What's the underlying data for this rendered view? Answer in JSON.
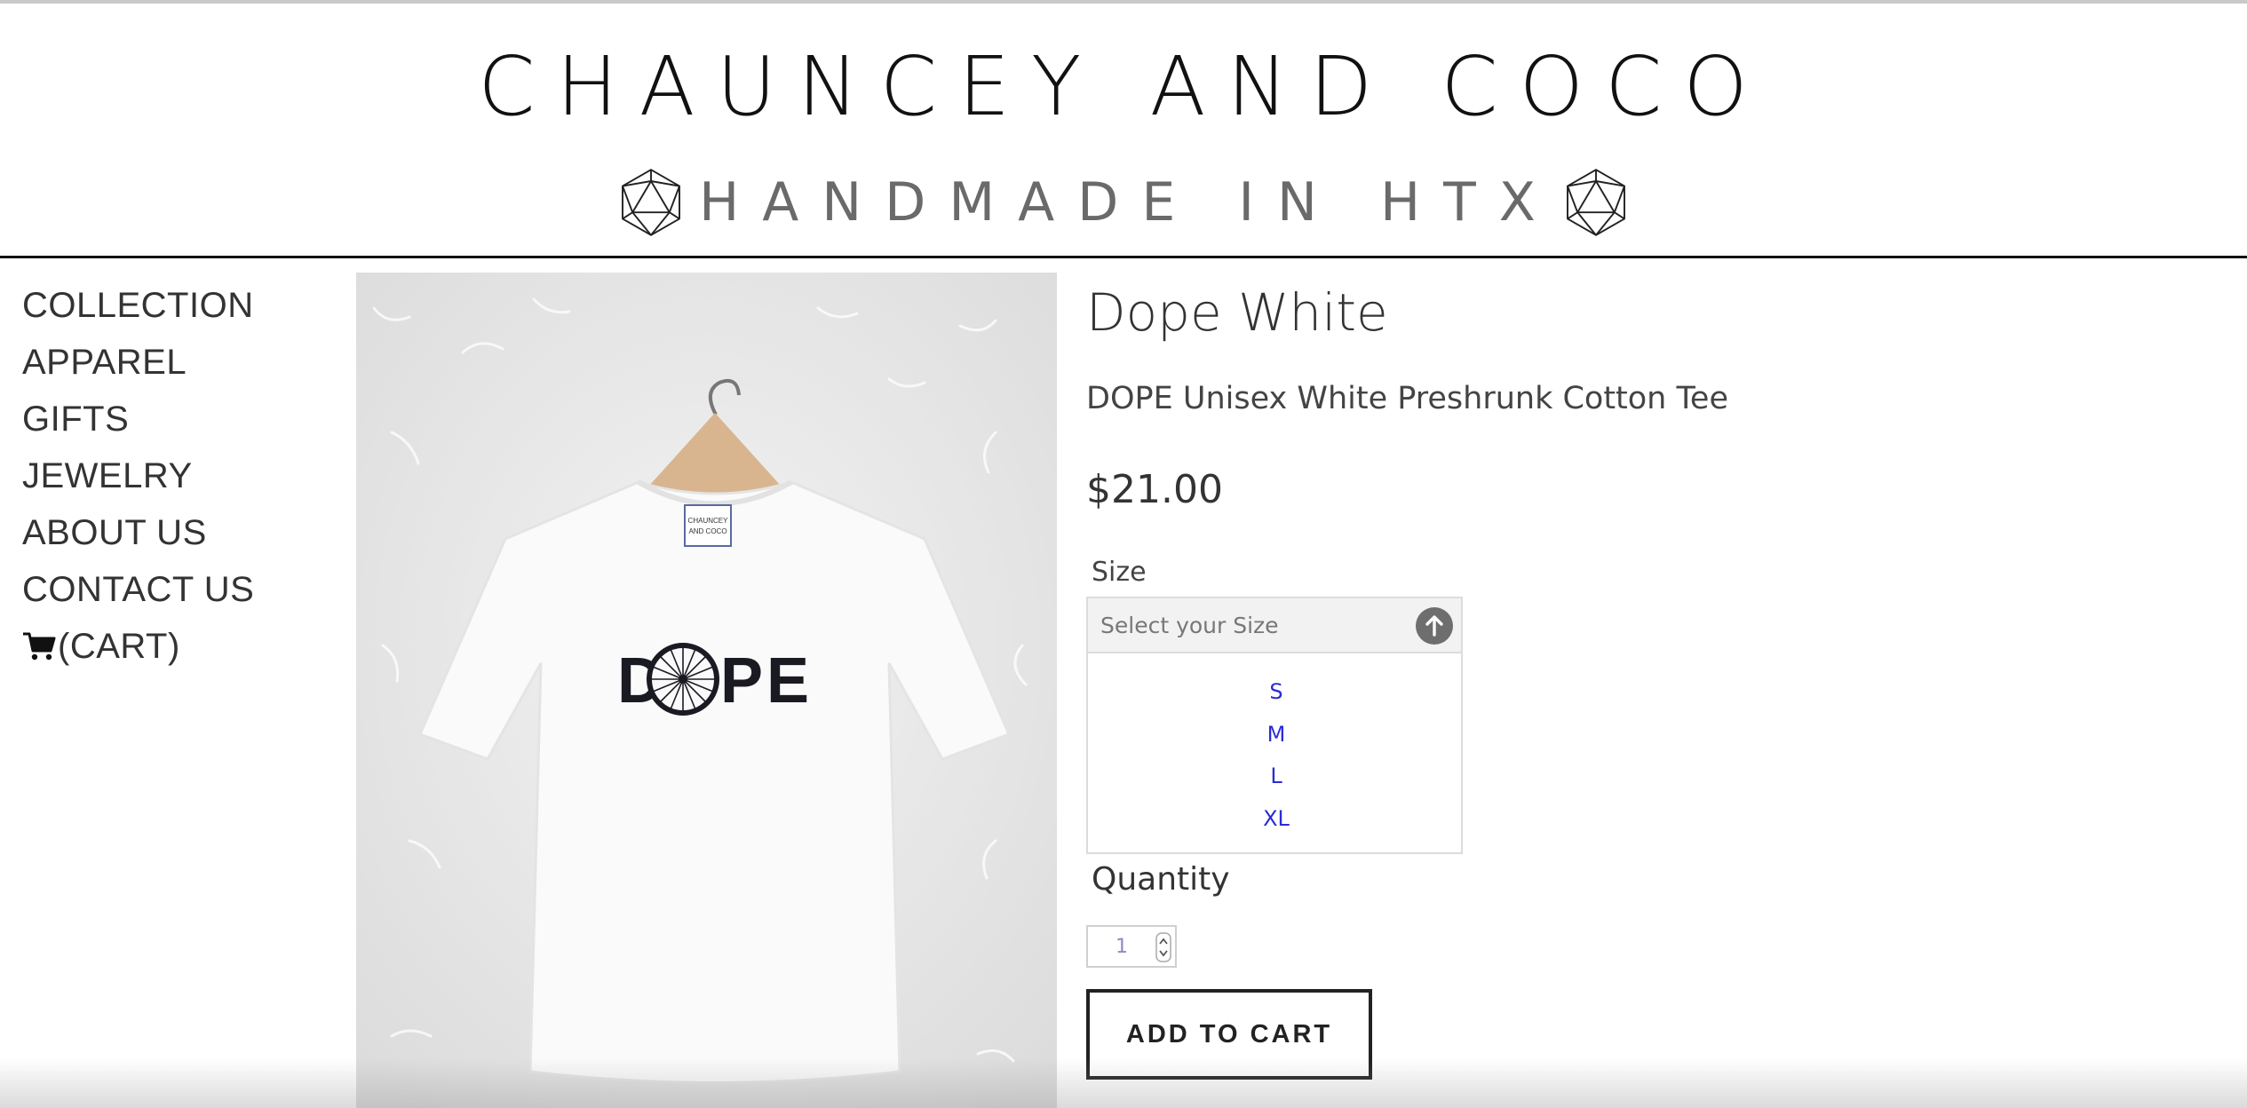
{
  "header": {
    "brand": "CHAUNCEY AND COCO",
    "tagline": "HANDMADE IN HTX",
    "left_icon": "geodesic-gem-icon",
    "right_icon": "geodesic-gem-icon"
  },
  "sidebar": {
    "items": [
      {
        "label": "COLLECTION"
      },
      {
        "label": "APPAREL"
      },
      {
        "label": "GIFTS"
      },
      {
        "label": "JEWELRY"
      },
      {
        "label": "ABOUT US"
      },
      {
        "label": "CONTACT US"
      }
    ],
    "cart": {
      "label": "(CART)",
      "icon": "shopping-cart-icon"
    }
  },
  "product": {
    "title": "Dope White",
    "description": "DOPE Unisex White Preshrunk Cotton Tee",
    "price": "$21.00",
    "image": {
      "shirt_print": "DOPE",
      "tag_line1": "CHAUNCEY",
      "tag_line2": "AND COCO"
    }
  },
  "size": {
    "label": "Size",
    "placeholder": "Select your Size",
    "toggle_icon": "arrow-up-circle-icon",
    "options": [
      "S",
      "M",
      "L",
      "XL"
    ]
  },
  "quantity": {
    "label": "Quantity",
    "value": "1"
  },
  "add_to_cart": {
    "label": "ADD TO CART"
  },
  "colors": {
    "accent_link": "#2b2bd6",
    "text": "#333333",
    "border": "#222222"
  }
}
